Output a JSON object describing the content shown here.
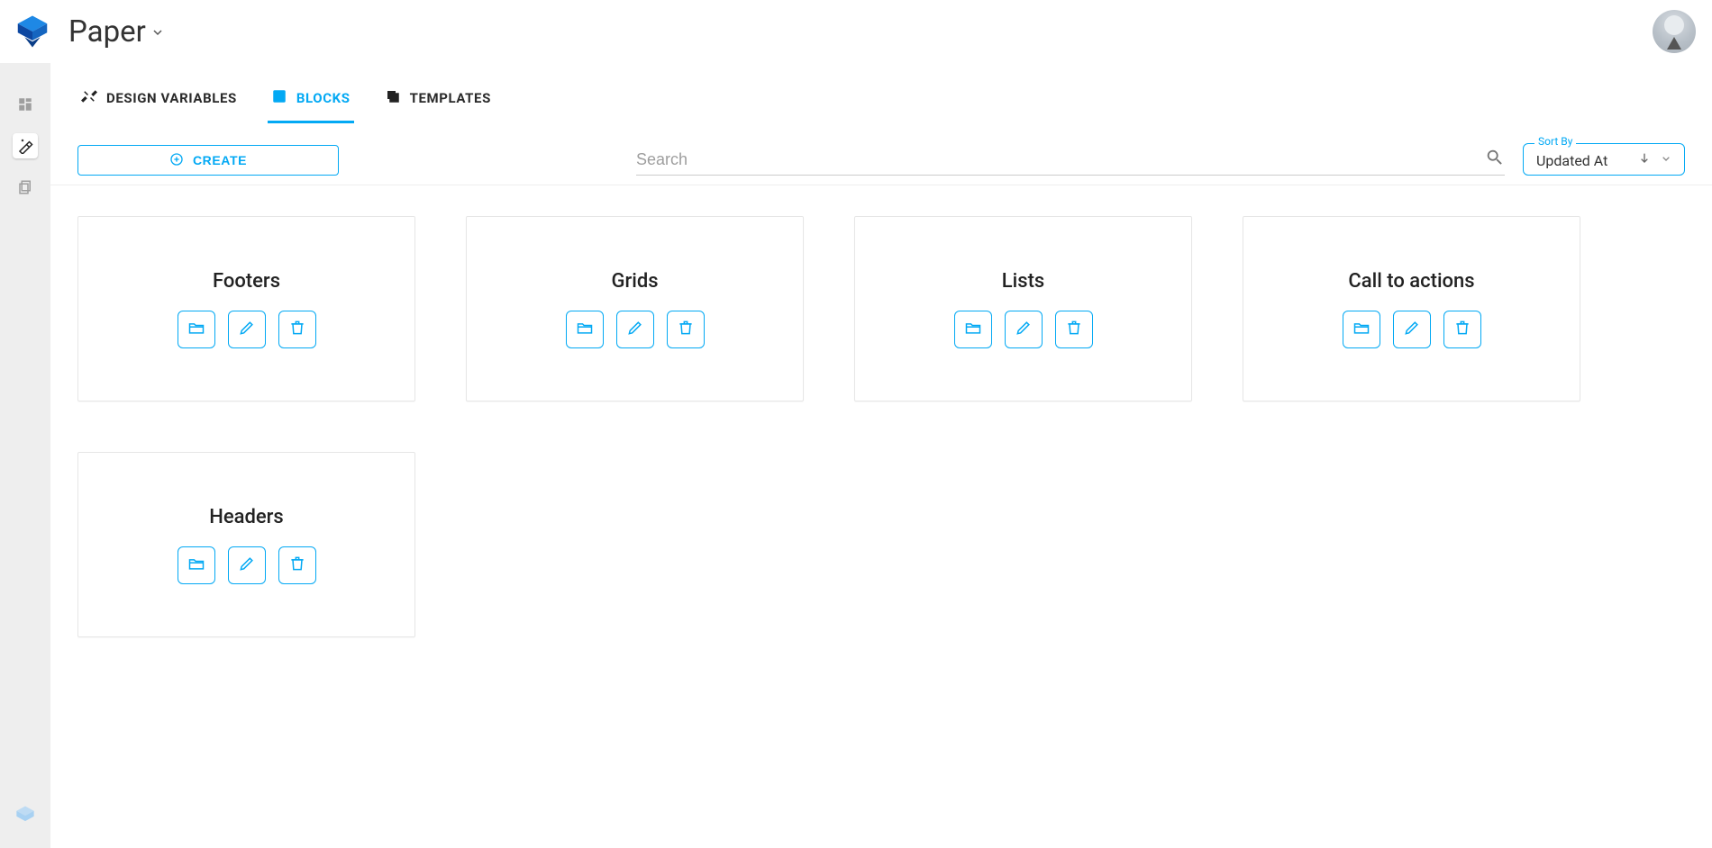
{
  "header": {
    "title": "Paper"
  },
  "tabs": [
    {
      "label": "DESIGN VARIABLES",
      "active": false
    },
    {
      "label": "BLOCKS",
      "active": true
    },
    {
      "label": "TEMPLATES",
      "active": false
    }
  ],
  "toolbar": {
    "create_label": "CREATE",
    "search_placeholder": "Search",
    "sort_label": "Sort By",
    "sort_value": "Updated At"
  },
  "cards": [
    {
      "title": "Footers"
    },
    {
      "title": "Grids"
    },
    {
      "title": "Lists"
    },
    {
      "title": "Call to actions"
    },
    {
      "title": "Headers"
    }
  ],
  "colors": {
    "accent": "#03a9f4"
  }
}
